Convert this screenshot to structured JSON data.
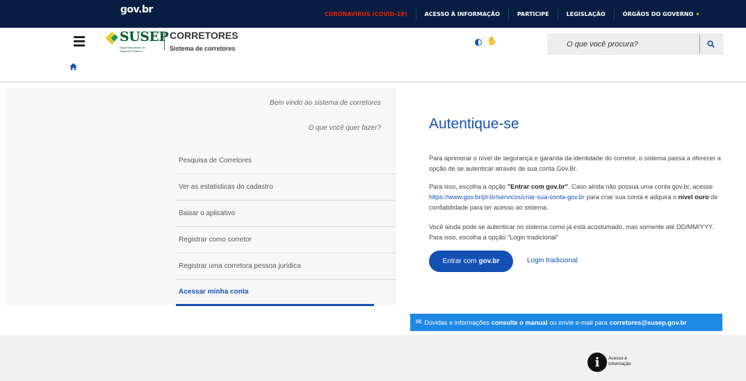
{
  "govbar": {
    "logo": "gov.br",
    "links": [
      {
        "label": "CORONAVÍRUS (COVID-19)"
      },
      {
        "label": "ACESSO À INFORMAÇÃO"
      },
      {
        "label": "PARTICIPE"
      },
      {
        "label": "LEGISLAÇÃO"
      },
      {
        "label": "ÓRGÃOS DO GOVERNO"
      }
    ],
    "chevron": "▾"
  },
  "header": {
    "logo_text": "SUSEP",
    "logo_sub": "Superintendência de Seguros Privados",
    "system_title": "CORRETORES",
    "system_subtitle": "Sistema de corretores",
    "search_placeholder": "O que você procura?",
    "search_icon": "search-icon",
    "accent": "#1351b4"
  },
  "breadcrumb": {
    "home_icon": "home-icon"
  },
  "left": {
    "welcome": "Bem vindo ao sistema de corretores",
    "question": "O que você quer fazer?",
    "menu": [
      {
        "label": "Pesquisa de Corretores"
      },
      {
        "label": "Ver as estatisticas do cadastro"
      },
      {
        "label": "Baixar o aplicativo"
      },
      {
        "label": "Registrar como corretor"
      },
      {
        "label": "Registrar uma corretora pessoa jurídica"
      },
      {
        "label": "Acessar minha conta"
      }
    ]
  },
  "auth": {
    "title": "Autentique-se",
    "p1": "Para aprimorar o nível de segurança e garantia da identidade do corretor, o sistema passa a oferecer a opção de se autenticar através de sua conta Gov.Br.",
    "p2_a": "Para isso, escolha a opção ",
    "p2_b": "\"Entrar com gov.br\"",
    "p2_c": ". Caso ainda não possua uma conta gov.br, acesse ",
    "p2_link": "https://www.gov.br/pt-br/servicos/criar-sua-conta-gov.br",
    "p2_d": " para criar sua conta e adquira o ",
    "p2_e": "nível ouro",
    "p2_f": " de confiabilidade para ter acesso ao sistema.",
    "p3": "Você ainda pode se autenticar no sistema como já está acostumado, mas somente até DD/MM/YYY. Para isso, escolha a opção \"Login tradicional\"",
    "btn_gov_a": "Entrar com",
    "btn_gov_b": "gov.br",
    "btn_trad": "Login tradicional"
  },
  "help": {
    "a": "Dúvidas e informações",
    "b": "consulte o manual",
    "c": "ou envie e-mail para",
    "d": "corretores@susep.gov.br"
  },
  "footer": {
    "ai_letter": "i",
    "ai_text": "Acesso à Informação"
  }
}
